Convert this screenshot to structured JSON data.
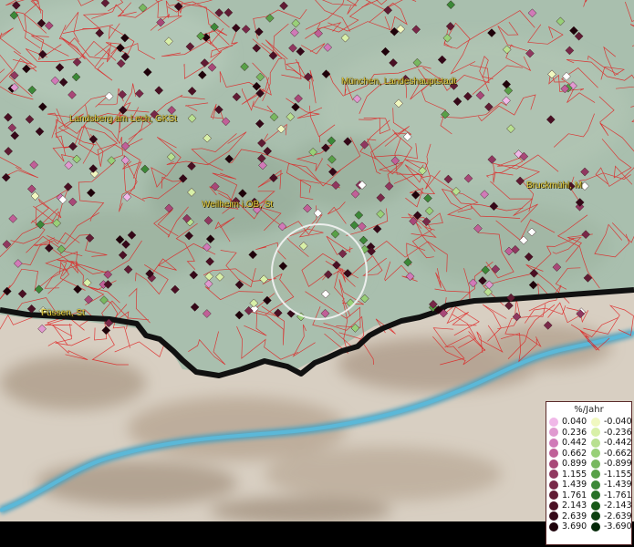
{
  "map": {
    "labels": {
      "muenchen": "München, Landeshauptstadt",
      "landsberg": "Landsberg am Lech, GKSt",
      "weilheim": "Weilheim i.OB, St",
      "bruckmuehl": "Bruckmühl, M",
      "fuessen": "Füssen, St"
    },
    "colors": {
      "boundary": "#e02020",
      "river": "#4aa0c0",
      "border": "#111111",
      "plain": "#a9bfae",
      "mountain": "#d8cfc2"
    }
  },
  "legend": {
    "title": "%/Jahr",
    "positive": [
      {
        "value": "0.040",
        "color": "#f0b8e8"
      },
      {
        "value": "0.236",
        "color": "#e09ad0"
      },
      {
        "value": "0.442",
        "color": "#d07ab8"
      },
      {
        "value": "0.662",
        "color": "#c06098"
      },
      {
        "value": "0.899",
        "color": "#a84878"
      },
      {
        "value": "1.155",
        "color": "#903860"
      },
      {
        "value": "1.439",
        "color": "#782848"
      },
      {
        "value": "1.761",
        "color": "#601c34"
      },
      {
        "value": "2.143",
        "color": "#4a1024"
      },
      {
        "value": "2.639",
        "color": "#340818"
      },
      {
        "value": "3.690",
        "color": "#1e020a"
      }
    ],
    "negative": [
      {
        "value": "-0.040",
        "color": "#f0f8c0"
      },
      {
        "value": "-0.236",
        "color": "#d8f0a8"
      },
      {
        "value": "-0.442",
        "color": "#b8e090"
      },
      {
        "value": "-0.662",
        "color": "#98d078"
      },
      {
        "value": "-0.899",
        "color": "#78b860"
      },
      {
        "value": "-1.155",
        "color": "#58a048"
      },
      {
        "value": "-1.439",
        "color": "#3c8838"
      },
      {
        "value": "-1.761",
        "color": "#287028"
      },
      {
        "value": "-2.143",
        "color": "#185818"
      },
      {
        "value": "-2.639",
        "color": "#0c4010"
      },
      {
        "value": "-3.690",
        "color": "#042808"
      }
    ]
  }
}
